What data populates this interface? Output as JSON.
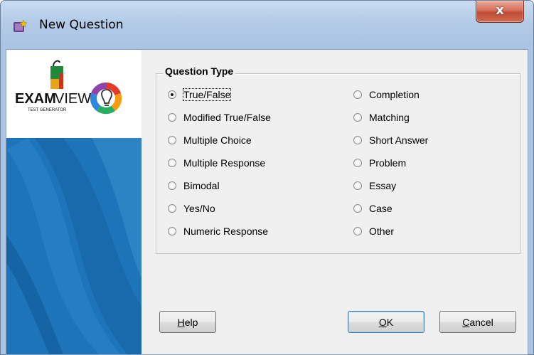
{
  "window": {
    "title": "New Question",
    "close_symbol": "x"
  },
  "logo": {
    "primary": "EXAM",
    "secondary": "VIEW",
    "tagline": "TEST GENERATOR"
  },
  "group": {
    "title": "Question Type",
    "left_options": [
      "True/False",
      "Modified True/False",
      "Multiple Choice",
      "Multiple Response",
      "Bimodal",
      "Yes/No",
      "Numeric Response"
    ],
    "right_options": [
      "Completion",
      "Matching",
      "Short Answer",
      "Problem",
      "Essay",
      "Case",
      "Other"
    ],
    "selected": "True/False"
  },
  "buttons": {
    "help": {
      "mnemonic": "H",
      "rest": "elp"
    },
    "ok": {
      "mnemonic": "O",
      "rest": "K"
    },
    "cancel": {
      "mnemonic": "C",
      "rest": "ancel"
    }
  },
  "colors": {
    "side_panel": "#1e74b9",
    "dialog_bg": "#f0f0f0",
    "title_bg": "#b3cbe7",
    "close_button": "#c24a33"
  }
}
